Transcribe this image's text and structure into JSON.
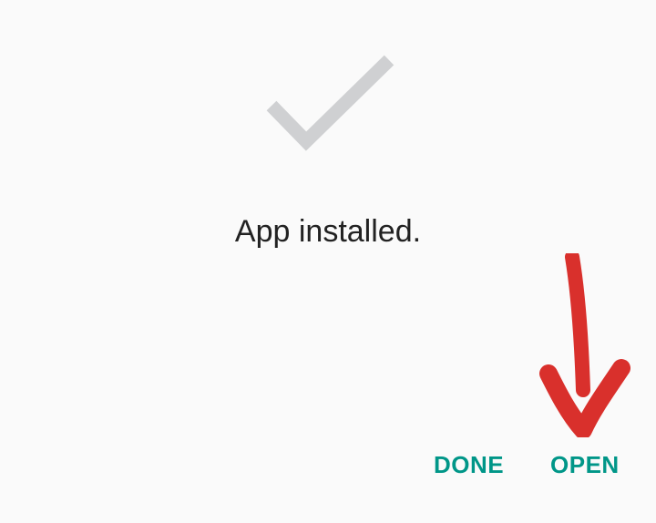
{
  "dialog": {
    "icon": "check-icon",
    "status_text": "App installed."
  },
  "actions": {
    "done_label": "DONE",
    "open_label": "OPEN"
  },
  "colors": {
    "background": "#fafafa",
    "check": "#cfd0d2",
    "text": "#222222",
    "accent": "#009688",
    "annotation": "#d9302c"
  },
  "annotation": {
    "icon": "red-arrow-down-icon"
  }
}
